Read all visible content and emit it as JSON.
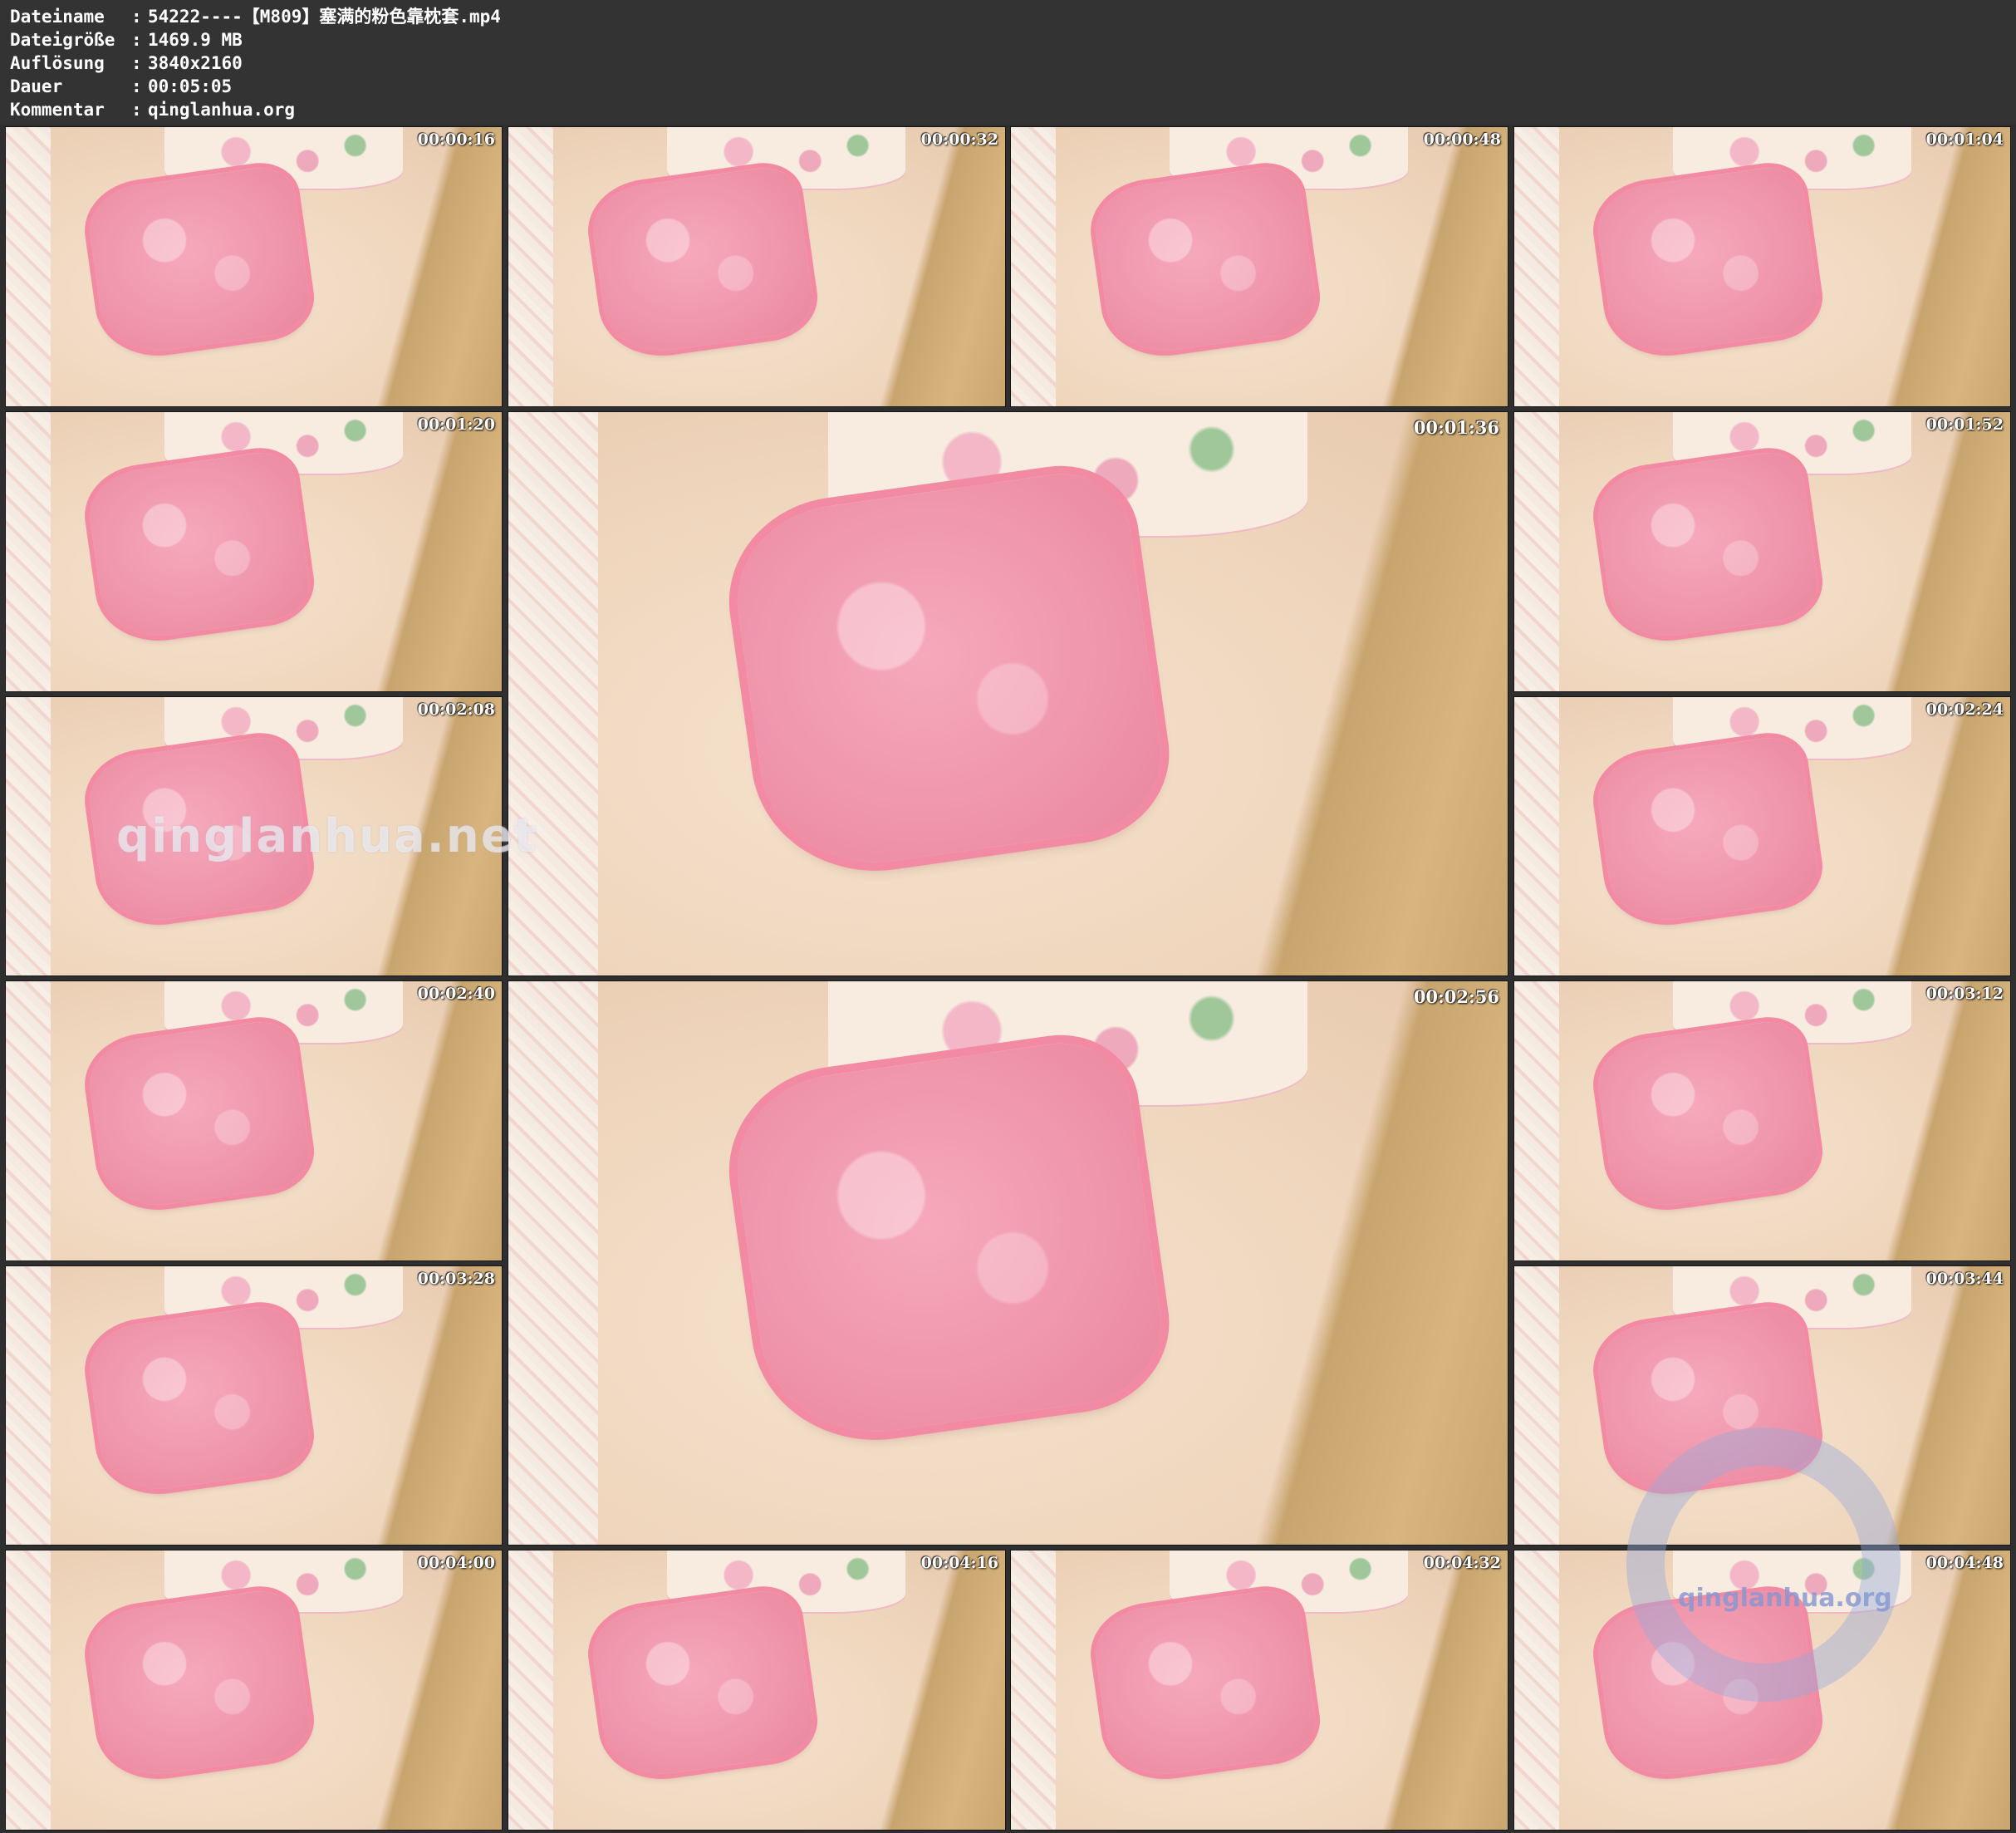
{
  "header": {
    "rows": [
      {
        "label": "Dateiname",
        "colon": ":",
        "value": "54222----【M809】塞满的粉色靠枕套.mp4"
      },
      {
        "label": "Dateigröße",
        "colon": ":",
        "value": "1469.9 MB"
      },
      {
        "label": "Auflösung",
        "colon": ":",
        "value": "3840x2160"
      },
      {
        "label": "Dauer",
        "colon": ":",
        "value": "00:05:05"
      },
      {
        "label": "Kommentar",
        "colon": ":",
        "value": "qinglanhua.org"
      }
    ]
  },
  "thumbnails": [
    {
      "timestamp": "00:00:16"
    },
    {
      "timestamp": "00:00:32"
    },
    {
      "timestamp": "00:00:48"
    },
    {
      "timestamp": "00:01:04"
    },
    {
      "timestamp": "00:01:20"
    },
    {
      "timestamp": "00:01:36"
    },
    {
      "timestamp": "00:01:52"
    },
    {
      "timestamp": "00:02:08"
    },
    {
      "timestamp": "00:02:24"
    },
    {
      "timestamp": "00:02:40"
    },
    {
      "timestamp": "00:02:56"
    },
    {
      "timestamp": "00:03:12"
    },
    {
      "timestamp": "00:03:28"
    },
    {
      "timestamp": "00:03:44"
    },
    {
      "timestamp": "00:04:00"
    },
    {
      "timestamp": "00:04:16"
    },
    {
      "timestamp": "00:04:32"
    },
    {
      "timestamp": "00:04:48"
    }
  ],
  "watermarks": {
    "center_text": "qinglanhua.net",
    "corner_text": "qinglanhua.org"
  }
}
